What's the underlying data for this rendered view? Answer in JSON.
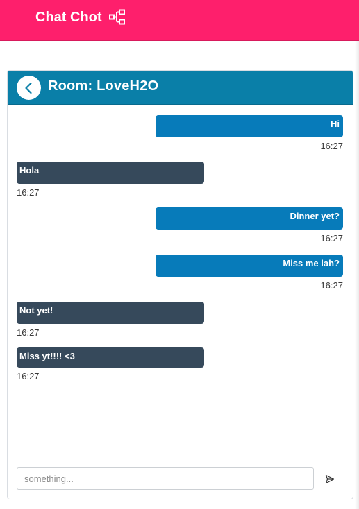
{
  "app": {
    "title": "Chat Chot",
    "brand_color": "#fe1f6c",
    "logo_icon": "network-icon"
  },
  "room": {
    "title": "Room: LoveH2O",
    "header_color": "#0a7fa8",
    "back_icon": "chevron-left-icon"
  },
  "messages": [
    {
      "sender": "me",
      "text": "Hi",
      "time": "16:27"
    },
    {
      "sender": "them",
      "text": "Hola",
      "time": "16:27"
    },
    {
      "sender": "me",
      "text": "Dinner yet?",
      "time": "16:27"
    },
    {
      "sender": "me",
      "text": "Miss me lah?",
      "time": "16:27"
    },
    {
      "sender": "them",
      "text": "Not yet!",
      "time": "16:27"
    },
    {
      "sender": "them",
      "text": "Miss yt!!!! <3",
      "time": "16:27"
    }
  ],
  "colors": {
    "my_bubble": "#077bba",
    "their_bubble": "#36495b"
  },
  "composer": {
    "placeholder": "something...",
    "value": "",
    "send_icon": "send-icon"
  }
}
